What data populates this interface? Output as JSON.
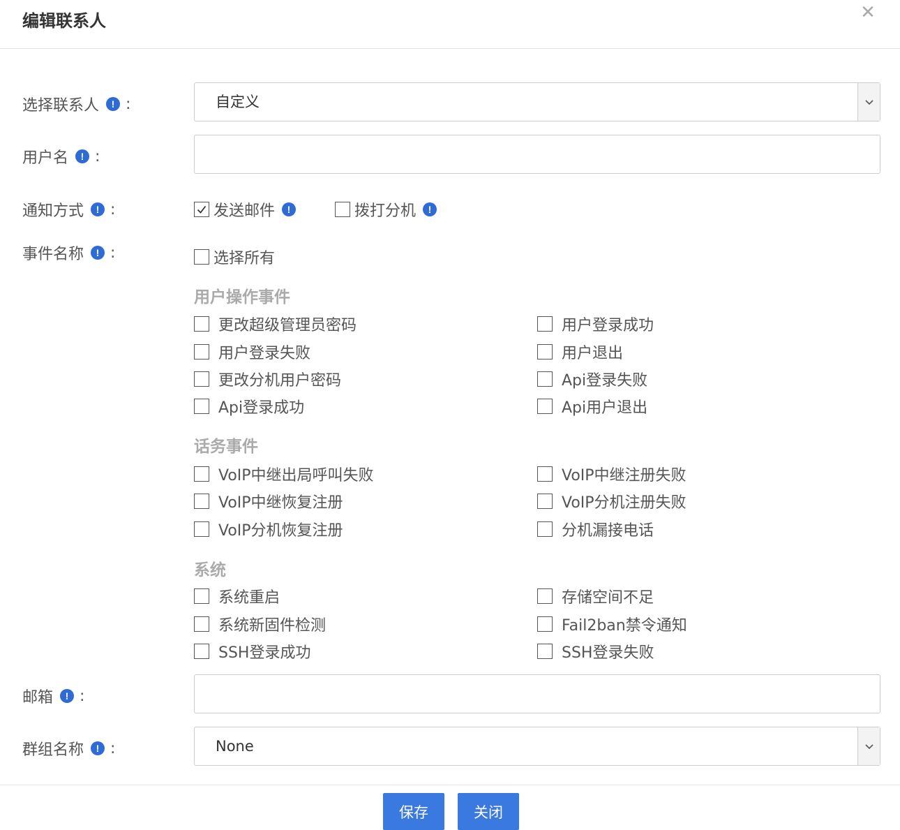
{
  "dialog": {
    "title": "编辑联系人",
    "close_glyph": "✕"
  },
  "form": {
    "contact": {
      "label": "选择联系人",
      "value": "自定义"
    },
    "username": {
      "label": "用户名",
      "value": ""
    },
    "notify": {
      "label": "通知方式",
      "options": [
        {
          "label": "发送邮件",
          "checked": true
        },
        {
          "label": "拨打分机",
          "checked": false
        }
      ]
    },
    "events": {
      "label": "事件名称",
      "select_all": "选择所有",
      "sections": [
        {
          "title": "用户操作事件",
          "items": [
            "更改超级管理员密码",
            "用户登录成功",
            "用户登录失败",
            "用户退出",
            "更改分机用户密码",
            "Api登录失败",
            "Api登录成功",
            "Api用户退出"
          ]
        },
        {
          "title": "话务事件",
          "items": [
            "VoIP中继出局呼叫失败",
            "VoIP中继注册失败",
            "VoIP中继恢复注册",
            "VoIP分机注册失败",
            "VoIP分机恢复注册",
            "分机漏接电话"
          ]
        },
        {
          "title": "系统",
          "items": [
            "系统重启",
            "存储空间不足",
            "系统新固件检测",
            "Fail2ban禁令通知",
            "SSH登录成功",
            "SSH登录失败"
          ]
        }
      ]
    },
    "email": {
      "label": "邮箱",
      "value": ""
    },
    "group": {
      "label": "群组名称",
      "value": "None"
    }
  },
  "footer": {
    "save_label": "保存",
    "close_label": "关闭"
  },
  "icons": {
    "info": "info-icon",
    "dropdown": "chevron-down-icon",
    "check": "checkmark-icon"
  },
  "colors": {
    "primary": "#3a7ae0",
    "info": "#2f6bd6",
    "section_title": "#aaaaaa"
  }
}
